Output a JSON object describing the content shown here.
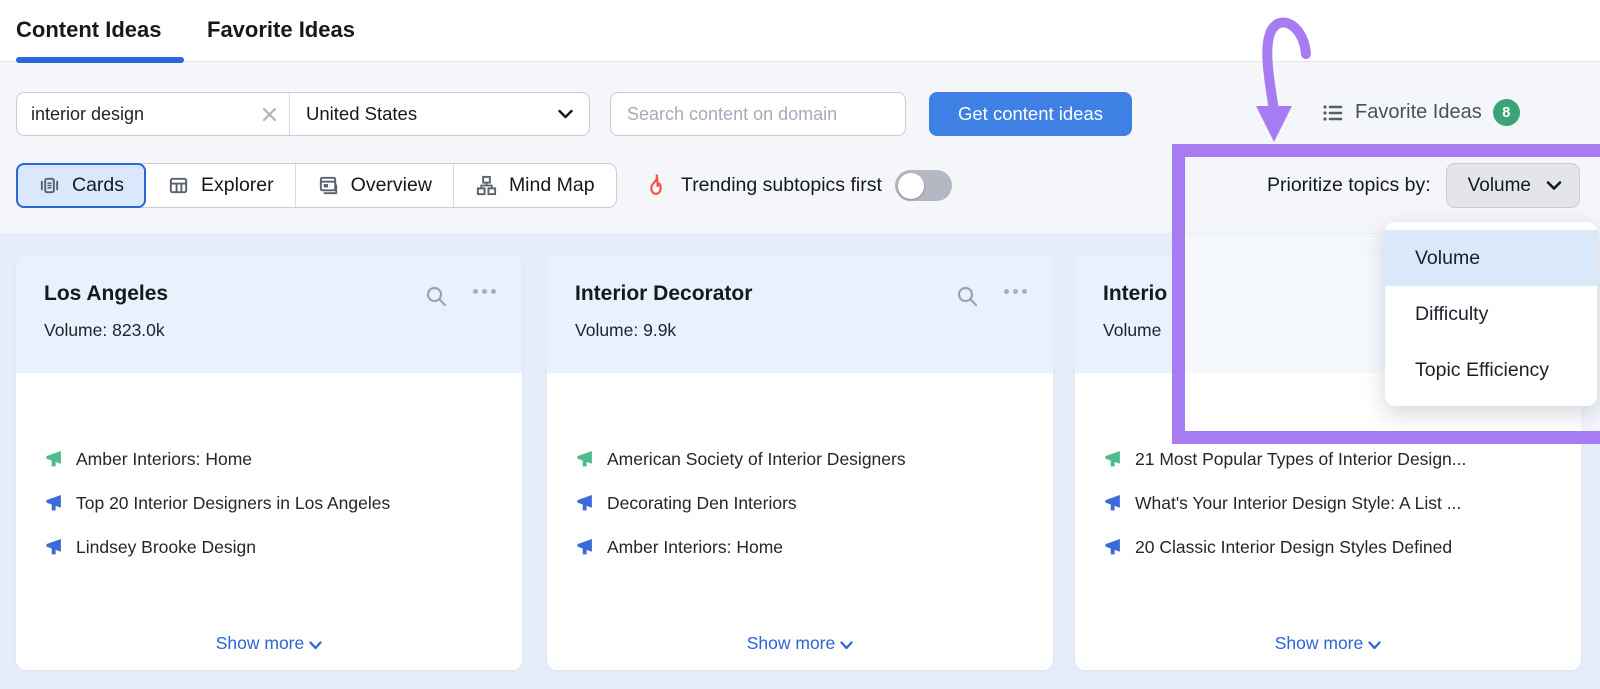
{
  "tabs": [
    {
      "label": "Content Ideas",
      "active": true
    },
    {
      "label": "Favorite Ideas",
      "active": false
    }
  ],
  "filters": {
    "keyword": {
      "value": "interior design"
    },
    "country": {
      "value": "United States"
    },
    "domain": {
      "placeholder": "Search content on domain"
    },
    "submit_label": "Get content ideas",
    "favorites": {
      "label": "Favorite Ideas",
      "count": "8"
    }
  },
  "views": [
    {
      "label": "Cards",
      "icon": "cards-icon",
      "selected": true
    },
    {
      "label": "Explorer",
      "icon": "table-icon",
      "selected": false
    },
    {
      "label": "Overview",
      "icon": "overview-icon",
      "selected": false
    },
    {
      "label": "Mind Map",
      "icon": "mindmap-icon",
      "selected": false
    }
  ],
  "trending": {
    "label": "Trending subtopics first",
    "icon": "flame-icon",
    "state": "off"
  },
  "prioritize": {
    "label": "Prioritize topics by:",
    "value": "Volume",
    "dropdown_items": [
      {
        "label": "Volume",
        "selected": true
      },
      {
        "label": "Difficulty",
        "selected": false
      },
      {
        "label": "Topic Efficiency",
        "selected": false
      }
    ]
  },
  "cards": [
    {
      "title": "Los Angeles",
      "volume_label": "Volume:",
      "volume_value": "823.0k",
      "items": [
        {
          "text": "Amber Interiors: Home",
          "icon": "megaphone-green"
        },
        {
          "text": "Top 20 Interior Designers in Los Angeles",
          "icon": "megaphone-blue"
        },
        {
          "text": "Lindsey Brooke Design",
          "icon": "megaphone-blue"
        }
      ],
      "show_more_label": "Show more"
    },
    {
      "title": "Interior Decorator",
      "volume_label": "Volume:",
      "volume_value": "9.9k",
      "items": [
        {
          "text": "American Society of Interior Designers",
          "icon": "megaphone-green"
        },
        {
          "text": "Decorating Den Interiors",
          "icon": "megaphone-blue"
        },
        {
          "text": "Amber Interiors: Home",
          "icon": "megaphone-blue"
        }
      ],
      "show_more_label": "Show more"
    },
    {
      "title": "Interio",
      "volume_label": "Volume",
      "volume_value": "",
      "items": [
        {
          "text": "21 Most Popular Types of Interior Design...",
          "icon": "megaphone-green"
        },
        {
          "text": "What's Your Interior Design Style: A List ...",
          "icon": "megaphone-blue"
        },
        {
          "text": "20 Classic Interior Design Styles Defined",
          "icon": "megaphone-blue"
        }
      ],
      "show_more_label": "Show more"
    }
  ],
  "colors": {
    "accent_blue": "#2a65d9",
    "button_blue": "#3f80e4",
    "badge_green": "#3aa479",
    "megaphone_green": "#4cbb8d",
    "megaphone_blue": "#3b6bd6",
    "annotation_purple": "#a77cf2",
    "card_header_bg": "#e9f2fc",
    "content_bg": "#e7edf8",
    "menu_highlight": "#d9e9fa",
    "flame_red": "#f2544a"
  }
}
